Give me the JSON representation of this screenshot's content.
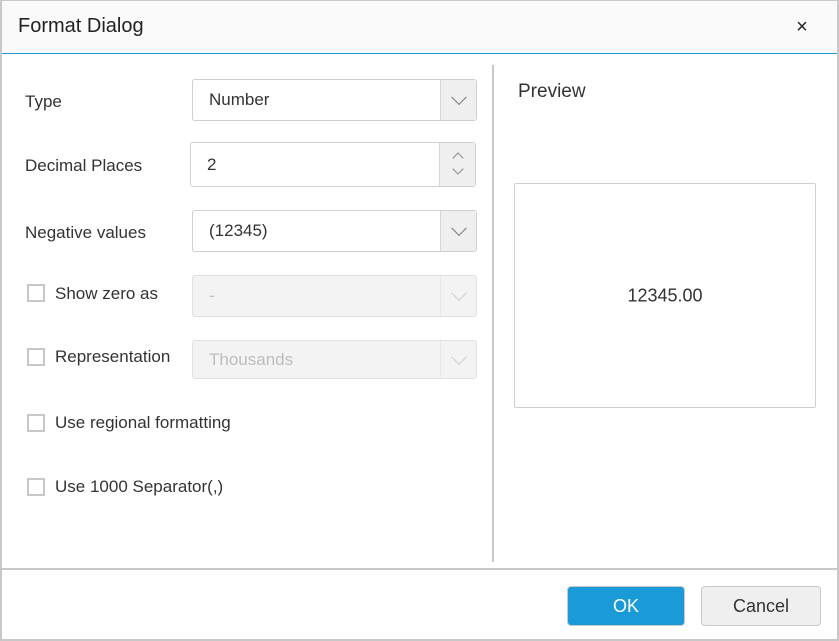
{
  "dialog": {
    "title": "Format Dialog",
    "close_label": "×"
  },
  "form": {
    "type": {
      "label": "Type",
      "value": "Number"
    },
    "decimal_places": {
      "label": "Decimal Places",
      "value": "2"
    },
    "negative_values": {
      "label": "Negative values",
      "value": "(12345)"
    },
    "show_zero_as": {
      "label": "Show zero as",
      "checked": false,
      "value": "-"
    },
    "representation": {
      "label": "Representation",
      "checked": false,
      "value": "Thousands"
    },
    "regional_formatting": {
      "label": "Use regional formatting",
      "checked": false
    },
    "thousand_separator": {
      "label": "Use 1000 Separator(,)",
      "checked": false
    }
  },
  "preview": {
    "title": "Preview",
    "value": "12345.00"
  },
  "footer": {
    "ok_label": "OK",
    "cancel_label": "Cancel"
  },
  "colors": {
    "accent": "#1a9bd7"
  }
}
